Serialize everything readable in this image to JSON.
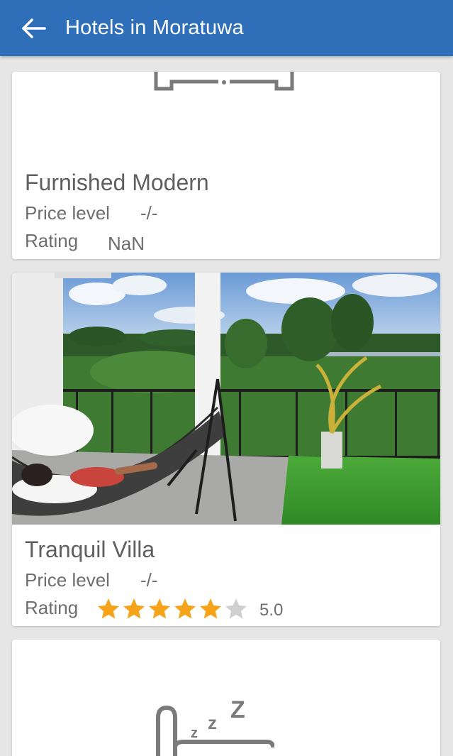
{
  "appbar": {
    "title": "Hotels in Moratuwa",
    "back_icon": "arrow-left-icon",
    "color": "#2f6fb9"
  },
  "hotels": [
    {
      "name": "Furnished Modern",
      "price_label": "Price level",
      "price_value": "-/-",
      "rating_label": "Rating",
      "rating_value": "NaN",
      "image": "placeholder-bed-icon"
    },
    {
      "name": "Tranquil Villa",
      "price_label": "Price level",
      "price_value": "-/-",
      "rating_label": "Rating",
      "rating_value": "5.0",
      "stars_filled": 5,
      "stars_total": 6,
      "star_color": "#f5a31a",
      "image": "photo-villa-balcony-hammock"
    },
    {
      "image": "placeholder-sleeping-icon"
    }
  ]
}
